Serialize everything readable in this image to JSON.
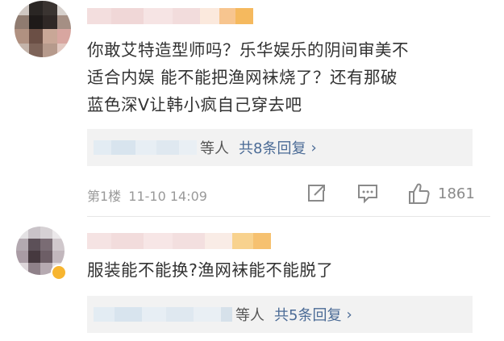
{
  "comments": [
    {
      "text_lines": [
        "你敢艾特造型师吗？乐华娱乐的阴间审美不",
        "适合内娱 能不能把渔网袜烧了？还有那破",
        "蓝色深V让韩小疯自己穿去吧"
      ],
      "replies_people_suffix": "等人",
      "replies_count_label": "共8条回复",
      "floor_label": "第1楼",
      "timestamp": "11-10 14:09",
      "like_count": "1861"
    },
    {
      "text_lines": [
        "服装能不能换?渔网袜能不能脱了"
      ],
      "replies_people_suffix": "等人",
      "replies_count_label": "共5条回复"
    }
  ],
  "icons": {
    "repost": "repost-icon",
    "comment": "comment-icon",
    "like": "thumbs-up-icon",
    "chevron": "chevron-right-icon"
  },
  "colors": {
    "link": "#4b6b96",
    "reply_bg": "#f2f2f2",
    "meta_text": "#999999",
    "badge": "#f7b530"
  }
}
